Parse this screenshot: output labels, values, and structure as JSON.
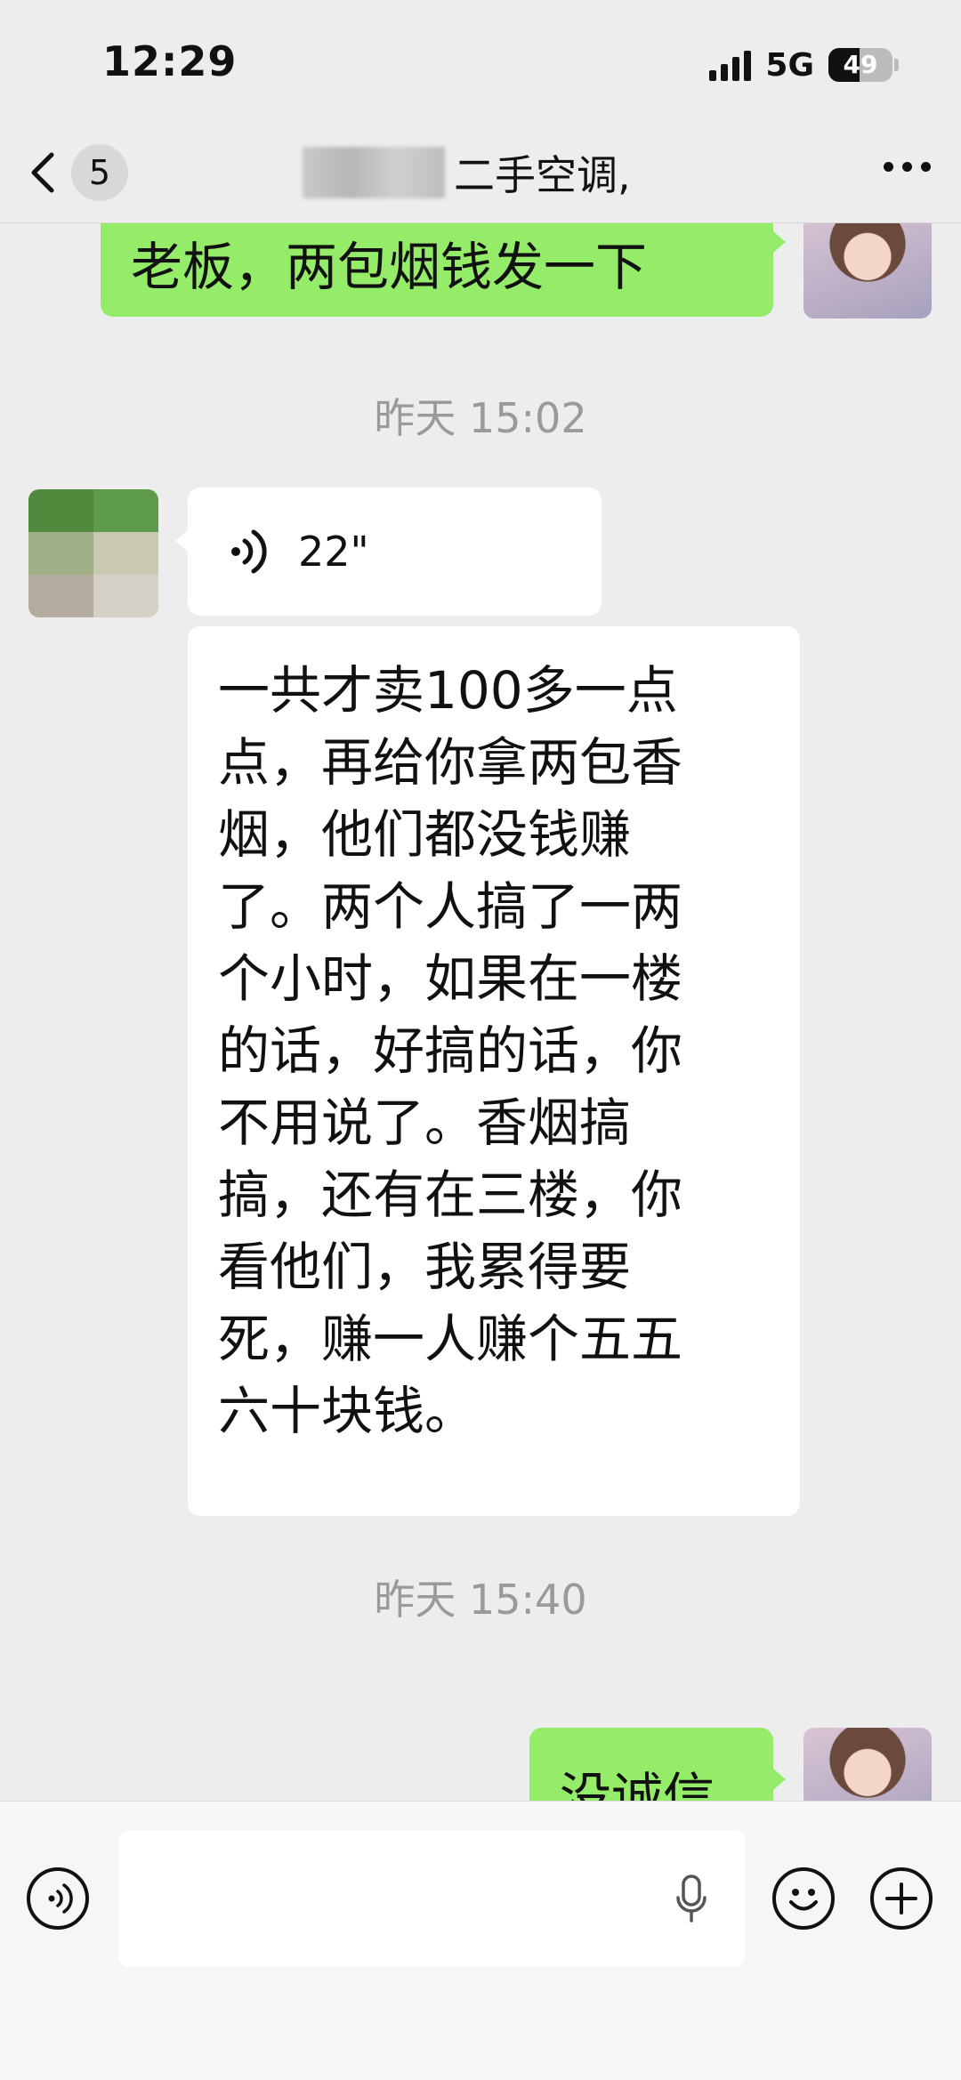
{
  "status_bar": {
    "time": "12:29",
    "network": "5G",
    "battery": "49",
    "battery_level": 0.49
  },
  "nav": {
    "back_count": "5",
    "title": "二手空调,"
  },
  "messages": {
    "sent_1": "老板，两包烟钱发一下",
    "timestamp_1": "昨天 15:02",
    "voice_duration": "22\"",
    "received_text_lines": [
      "一共才卖100多一点",
      "点，再给你拿两包香",
      "烟，他们都没钱赚",
      "了。两个人搞了一两",
      "个小时，如果在一楼",
      "的话，好搞的话，你",
      "不用说了。香烟搞",
      "搞，还有在三楼，你",
      "看他们，我累得要",
      "死，赚一人赚个五五",
      "六十块钱。"
    ],
    "timestamp_2": "昨天 15:40",
    "sent_2": "没诚信"
  },
  "icons": {
    "back": "chevron-left-icon",
    "more": "more-dots-icon",
    "voice_play": "voice-wave-icon",
    "voice_mode": "voice-mode-icon",
    "mic": "microphone-icon",
    "emoji": "emoji-icon",
    "add": "plus-circle-icon"
  },
  "colors": {
    "sent_bubble": "#95ec69",
    "received_bubble": "#ffffff",
    "background": "#ededed"
  }
}
